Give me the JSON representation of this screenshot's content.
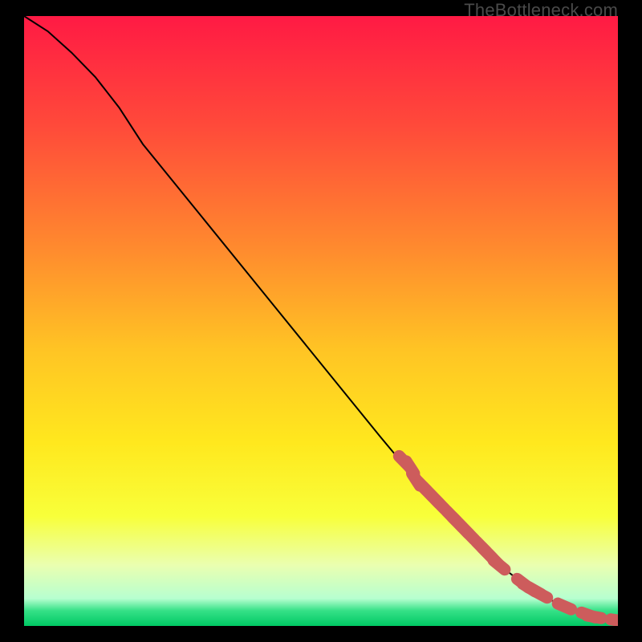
{
  "watermark": "TheBottleneck.com",
  "colors": {
    "curve": "#000000",
    "marker": "#cd5c5c",
    "frame_bg": "#000000"
  },
  "gradient_stops": [
    {
      "offset": 0.0,
      "color": "#ff1a44"
    },
    {
      "offset": 0.18,
      "color": "#ff4a3a"
    },
    {
      "offset": 0.38,
      "color": "#ff8a2e"
    },
    {
      "offset": 0.55,
      "color": "#ffc524"
    },
    {
      "offset": 0.7,
      "color": "#ffe81e"
    },
    {
      "offset": 0.82,
      "color": "#f8ff3a"
    },
    {
      "offset": 0.9,
      "color": "#eaffb0"
    },
    {
      "offset": 0.955,
      "color": "#b7ffd0"
    },
    {
      "offset": 0.975,
      "color": "#35e187"
    },
    {
      "offset": 1.0,
      "color": "#00c864"
    }
  ],
  "chart_data": {
    "type": "line",
    "title": "",
    "xlabel": "",
    "ylabel": "",
    "xlim": [
      0,
      100
    ],
    "ylim": [
      0,
      100
    ],
    "curve": {
      "x": [
        0,
        4,
        8,
        12,
        16,
        20,
        30,
        40,
        50,
        60,
        66,
        68,
        70,
        72,
        74,
        76,
        78,
        80,
        82,
        84,
        86,
        88,
        90,
        92,
        94,
        96,
        98,
        100
      ],
      "y": [
        100,
        97.5,
        94,
        90,
        85,
        79,
        67,
        55,
        43,
        31,
        24,
        22,
        20,
        18,
        16,
        14,
        12,
        10,
        8.5,
        7,
        5.8,
        4.6,
        3.6,
        2.8,
        2.0,
        1.4,
        1.0,
        0.9
      ]
    },
    "markers": {
      "x": [
        64,
        65,
        66,
        67,
        68,
        69,
        70,
        72,
        73,
        74,
        75,
        77,
        78,
        79,
        80,
        84,
        85,
        86,
        87,
        91,
        95,
        96,
        100
      ],
      "y": [
        27.0,
        26.0,
        24.0,
        23.0,
        22.0,
        21.0,
        20.0,
        18.0,
        17.0,
        16.0,
        15.0,
        13.0,
        12.0,
        11.0,
        10.0,
        7.0,
        6.3,
        5.8,
        5.2,
        3.2,
        1.8,
        1.5,
        0.9
      ]
    }
  }
}
